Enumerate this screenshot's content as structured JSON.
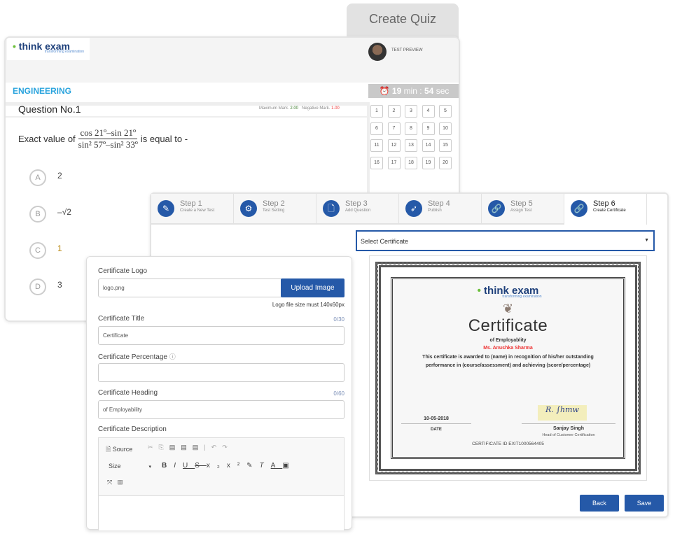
{
  "header": {
    "tab_label": "Create Quiz"
  },
  "quiz": {
    "logo": "think exam",
    "logo_tagline": "transforming examination",
    "test_preview": "TEST PREVIEW",
    "subject": "ENGINEERING",
    "timer_min": "19",
    "timer_sec": "54",
    "timer_text_min": "min :",
    "timer_text_sec": "sec",
    "question_title": "Question No.1",
    "max_mark_label": "Maximum Mark.",
    "max_mark": "2.00",
    "neg_mark_label": "Negative Mark.",
    "neg_mark": "1.00",
    "question_prefix": "Exact value of",
    "numerator": "cos 21º–sin 21º",
    "denominator": "sin² 57º–sin² 33º",
    "question_suffix": "is equal to -",
    "options": [
      {
        "letter": "A",
        "value": "2"
      },
      {
        "letter": "B",
        "value": "–√2"
      },
      {
        "letter": "C",
        "value": "1"
      },
      {
        "letter": "D",
        "value": "3"
      }
    ],
    "question_numbers": [
      "1",
      "2",
      "3",
      "4",
      "5",
      "6",
      "7",
      "8",
      "9",
      "10",
      "11",
      "12",
      "13",
      "14",
      "15",
      "16",
      "17",
      "18",
      "19",
      "20"
    ],
    "accent": "#29a3dd"
  },
  "wizard": {
    "steps": [
      {
        "title": "Step 1",
        "sub": "Create a New Test",
        "icon": "pencil-icon"
      },
      {
        "title": "Step 2",
        "sub": "Test Setting",
        "icon": "gear-icon"
      },
      {
        "title": "Step 3",
        "sub": "Add Question",
        "icon": "add-document-icon"
      },
      {
        "title": "Step 4",
        "sub": "Publish",
        "icon": "rocket-icon"
      },
      {
        "title": "Step 5",
        "sub": "Assign Test",
        "icon": "link-icon"
      },
      {
        "title": "Step 6",
        "sub": "Create Certificate",
        "icon": "link-icon"
      }
    ],
    "active_step": 6,
    "select_certificate": "Select Certificate",
    "back": "Back",
    "save": "Save",
    "primary": "#2559a8"
  },
  "certificate": {
    "logo": "think exam",
    "logo_tagline": "transforming examination",
    "title": "Certificate",
    "heading": "of Employablity",
    "name": "Ms. Anushka Sharma",
    "body": "This certificate is awarded to (name) in recognition of his/her outstanding performance in (course/assessment) and achieving (score/percentage)",
    "date": "10-05-2018",
    "date_label": "DATE",
    "signer": "Sanjay Singh",
    "signer_title": "Head of Customer Certification",
    "certificate_id": "CERTIFICATE ID EXIT1000564405"
  },
  "form": {
    "logo_label": "Certificate Logo",
    "logo_value": "logo.png",
    "upload": "Upload Image",
    "logo_hint": "Logo file size must 140x60px",
    "title_label": "Certificate Title",
    "title_count": "0/30",
    "title_placeholder": "Certificate",
    "percentage_label": "Certificate Percentage",
    "heading_label": "Certificate Heading",
    "heading_count": "0/60",
    "heading_placeholder": "of Employability",
    "description_label": "Certificate Description",
    "editor": {
      "source": "Source",
      "size": "Size"
    }
  }
}
